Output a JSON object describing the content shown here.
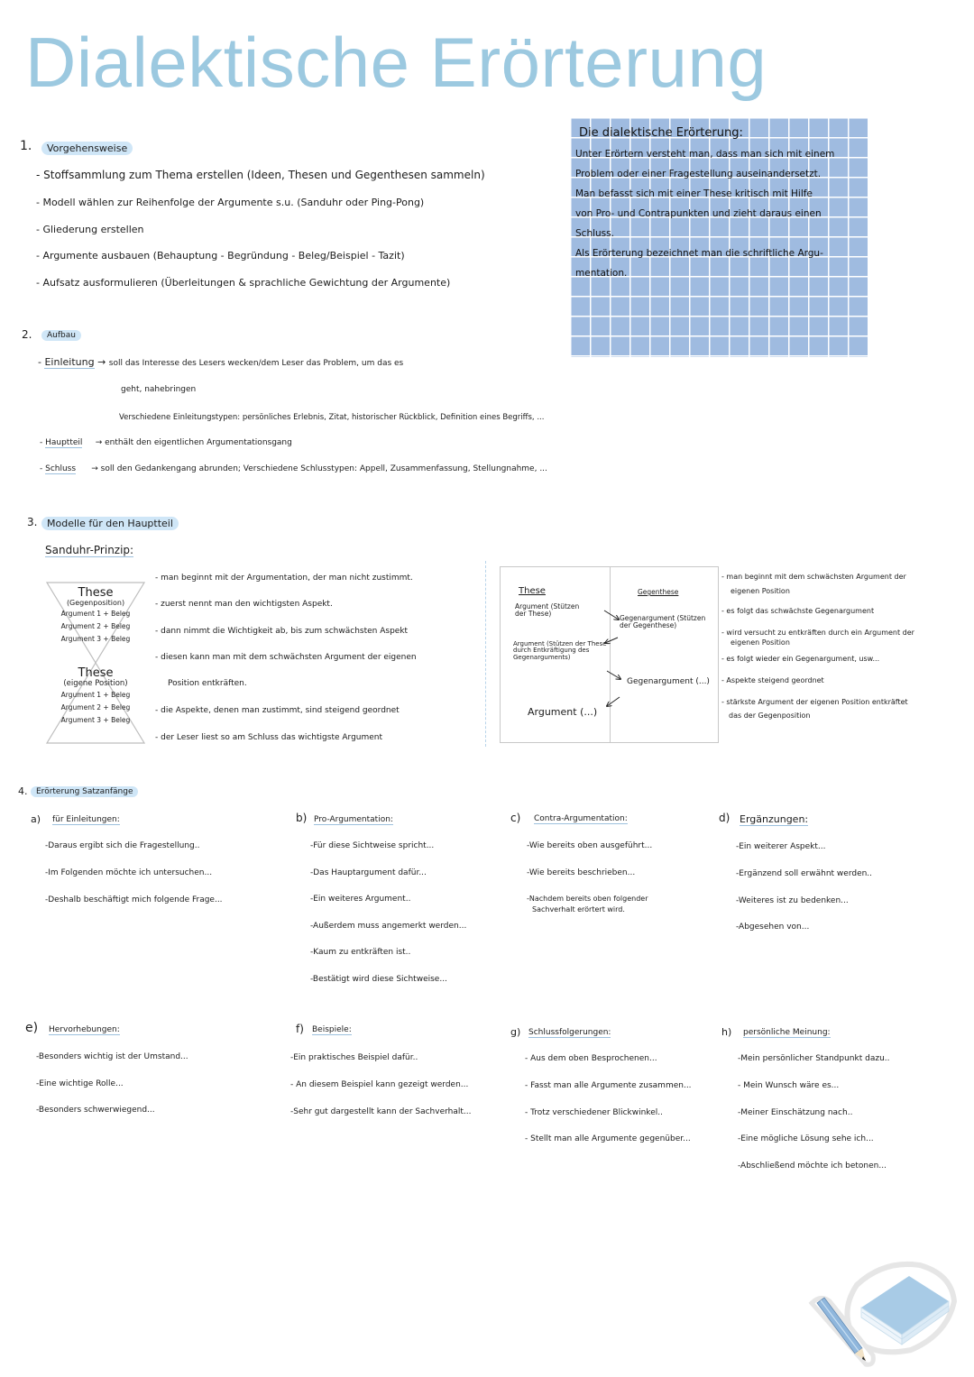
{
  "title": "Dialektische Erörterung",
  "definition_box": {
    "heading": "Die dialektische Erörterung:",
    "lines": [
      "Unter Erörtern versteht man, dass man sich mit einem",
      "Problem oder einer Fragestellung auseinandersetzt.",
      "Man befasst sich mit einer These kritisch mit Hilfe",
      "von Pro- und Contrapunkten und zieht daraus einen",
      "Schluss.",
      "Als Erörterung bezeichnet man die schriftliche Argu-",
      "mentation."
    ]
  },
  "section1": {
    "number": "1.",
    "heading": "Vorgehensweise",
    "items": [
      "- Stoffsammlung zum Thema erstellen (Ideen, Thesen und Gegenthesen sammeln)",
      "- Modell wählen zur Reihenfolge der Argumente s.u. (Sanduhr oder Ping-Pong)",
      "- Gliederung erstellen",
      "- Argumente ausbauen (Behauptung - Begründung - Beleg/Beispiel - Tazit)",
      "- Aufsatz ausformulieren (Überleitungen & sprachliche Gewichtung der Argumente)"
    ]
  },
  "section2": {
    "number": "2.",
    "heading": "Aufbau",
    "einleitung": {
      "label": "Einleitung",
      "arrow": "→",
      "text1": "soll das Interesse des Lesers wecken/dem Leser das Problem, um das es",
      "text2": "geht, nahebringen",
      "text3": "Verschiedene Einleitungstypen: persönliches Erlebnis, Zitat, historischer Rückblick, Definition eines Begriffs, ..."
    },
    "hauptteil": {
      "label": "Hauptteil",
      "arrow": "→",
      "text": "enthält den eigentlichen Argumentationsgang"
    },
    "schluss": {
      "label": "Schluss",
      "arrow": "→",
      "text": "soll den Gedankengang abrunden; Verschiedene Schlusstypen: Appell, Zusammenfassung, Stellungnahme, ..."
    }
  },
  "section3": {
    "number": "3.",
    "heading": "Modelle für den Hauptteil",
    "sanduhr": {
      "title": "Sanduhr-Prinzip:",
      "top": {
        "these": "These",
        "position": "(Gegenposition)",
        "args": [
          "Argument 1 + Beleg",
          "Argument 2 + Beleg",
          "Argument 3 + Beleg"
        ]
      },
      "bottom": {
        "these": "These",
        "position": "(eigene Position)",
        "args": [
          "Argument 1 + Beleg",
          "Argument 2 + Beleg",
          "Argument 3 + Beleg"
        ]
      },
      "notes": [
        "- man beginnt mit der Argumentation, der man nicht zustimmt.",
        "- zuerst nennt man den wichtigsten Aspekt.",
        "- dann nimmt die Wichtigkeit ab, bis zum schwächsten Aspekt",
        "- diesen kann man mit dem schwächsten Argument der eigenen",
        "Position entkräften.",
        "- die Aspekte, denen man zustimmt, sind steigend geordnet",
        "- der Leser liest so am Schluss das wichtigste Argument"
      ]
    },
    "pingpong": {
      "col_left": "These",
      "col_right": "Gegenthese",
      "arg1": "Argument (Stützen der These)",
      "gegen1": "Gegenargument (Stützen der Gegenthese)",
      "arg2": "Argument (Stützen der These durch Entkräftigung des Gegenarguments)",
      "gegen2": "Gegenargument (...)",
      "arg3": "Argument (...)",
      "notes": [
        "- man beginnt mit dem schwächsten Argument der",
        "eigenen Position",
        "- es folgt das schwächste Gegenargument",
        "- wird versucht zu entkräften durch ein Argument der",
        "eigenen Position",
        "- es folgt wieder ein Gegenargument, usw...",
        "- Aspekte steigend geordnet",
        "- stärkste Argument der eigenen Position entkräftet",
        "das der Gegenposition"
      ]
    }
  },
  "section4": {
    "number": "4.",
    "heading": "Erörterung Satzanfänge",
    "groups": [
      {
        "letter": "a)",
        "title": "für Einleitungen:",
        "items": [
          "-Daraus ergibt sich die Fragestellung..",
          "-Im Folgenden möchte ich untersuchen...",
          "-Deshalb beschäftigt mich folgende Frage..."
        ]
      },
      {
        "letter": "b)",
        "title": "Pro-Argumentation:",
        "items": [
          "-Für diese Sichtweise spricht...",
          "-Das Hauptargument dafür...",
          "-Ein weiteres Argument..",
          "-Außerdem muss angemerkt werden...",
          "-Kaum zu entkräften ist..",
          "-Bestätigt wird diese Sichtweise..."
        ]
      },
      {
        "letter": "c)",
        "title": "Contra-Argumentation:",
        "items": [
          "-Wie bereits oben ausgeführt...",
          "-Wie bereits beschrieben...",
          "-Nachdem bereits oben folgender",
          "Sachverhalt erörtert wird."
        ]
      },
      {
        "letter": "d)",
        "title": "Ergänzungen:",
        "items": [
          "-Ein weiterer Aspekt...",
          "-Ergänzend soll erwähnt werden..",
          "-Weiteres ist zu bedenken...",
          "-Abgesehen von..."
        ]
      },
      {
        "letter": "e)",
        "title": "Hervorhebungen:",
        "items": [
          "-Besonders wichtig ist der Umstand...",
          "-Eine wichtige Rolle...",
          "-Besonders schwerwiegend..."
        ]
      },
      {
        "letter": "f)",
        "title": "Beispiele:",
        "items": [
          "-Ein praktisches Beispiel dafür..",
          "- An diesem Beispiel kann gezeigt werden...",
          "-Sehr gut dargestellt kann der Sachverhalt..."
        ]
      },
      {
        "letter": "g)",
        "title": "Schlussfolgerungen:",
        "items": [
          "- Aus dem oben Besprochenen...",
          "- Fasst man alle Argumente zusammen...",
          "- Trotz verschiedener Blickwinkel..",
          "- Stellt man alle Argumente gegenüber..."
        ]
      },
      {
        "letter": "h)",
        "title": "persönliche Meinung:",
        "items": [
          "-Mein persönlicher Standpunkt dazu..",
          "- Mein Wunsch wäre es...",
          "-Meiner Einschätzung nach..",
          "-Eine mögliche Lösung sehe ich...",
          "-Abschließend möchte ich betonen..."
        ]
      }
    ]
  },
  "decoration": {
    "icon": "book-and-pencil-sticker"
  },
  "colors": {
    "title": "#9cc9e0",
    "highlight": "#cfe6f7",
    "grid": "#9fbbe0",
    "underline": "#9cc0dd"
  }
}
